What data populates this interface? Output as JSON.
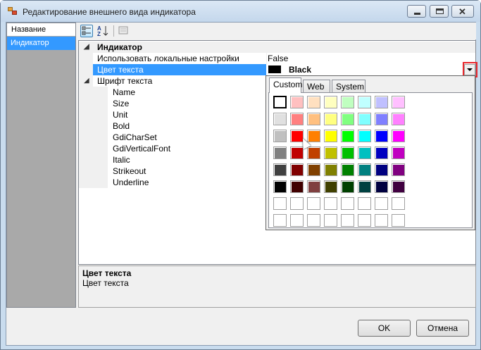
{
  "window": {
    "title": "Редактирование внешнего вида индикатора"
  },
  "left_list": {
    "header": "Название",
    "items": [
      "Индикатор"
    ]
  },
  "property_grid": {
    "category": "Индикатор",
    "rows": [
      {
        "name": "Использовать локальные настройки",
        "value": "False"
      },
      {
        "name": "Цвет текста",
        "value": "Black",
        "selected": true
      },
      {
        "name": "Шрифт текста",
        "value": ""
      }
    ],
    "font_subrows": [
      "Name",
      "Size",
      "Unit",
      "Bold",
      "GdiCharSet",
      "GdiVerticalFont",
      "Italic",
      "Strikeout",
      "Underline"
    ],
    "swatch_color": "#000000"
  },
  "description": {
    "title": "Цвет текста",
    "text": "Цвет текста"
  },
  "buttons": {
    "ok": "OK",
    "cancel": "Отмена"
  },
  "color_picker": {
    "tabs": [
      "Custom",
      "Web",
      "System"
    ],
    "active_tab": "Custom",
    "selected": [
      0,
      0
    ],
    "grid": [
      [
        "#ffffff",
        "#ffc0c0",
        "#ffe0c0",
        "#ffffc0",
        "#c0ffc0",
        "#c0ffff",
        "#c0c0ff",
        "#ffc0ff"
      ],
      [
        "#e0e0e0",
        "#ff8080",
        "#ffc080",
        "#ffff80",
        "#80ff80",
        "#80ffff",
        "#8080ff",
        "#ff80ff"
      ],
      [
        "#c0c0c0",
        "#ff0000",
        "#ff8000",
        "#ffff00",
        "#00ff00",
        "#00ffff",
        "#0000ff",
        "#ff00ff"
      ],
      [
        "#808080",
        "#c00000",
        "#c04000",
        "#c0c000",
        "#00c000",
        "#00c0c0",
        "#0000c0",
        "#c000c0"
      ],
      [
        "#404040",
        "#800000",
        "#804000",
        "#808000",
        "#008000",
        "#008080",
        "#000080",
        "#800080"
      ],
      [
        "#000000",
        "#400000",
        "#804040",
        "#404000",
        "#004000",
        "#004040",
        "#000040",
        "#400040"
      ],
      [
        "#ffffff",
        "#ffffff",
        "#ffffff",
        "#ffffff",
        "#ffffff",
        "#ffffff",
        "#ffffff",
        "#ffffff"
      ],
      [
        "#ffffff",
        "#ffffff",
        "#ffffff",
        "#ffffff",
        "#ffffff",
        "#ffffff",
        "#ffffff",
        "#ffffff"
      ]
    ]
  }
}
